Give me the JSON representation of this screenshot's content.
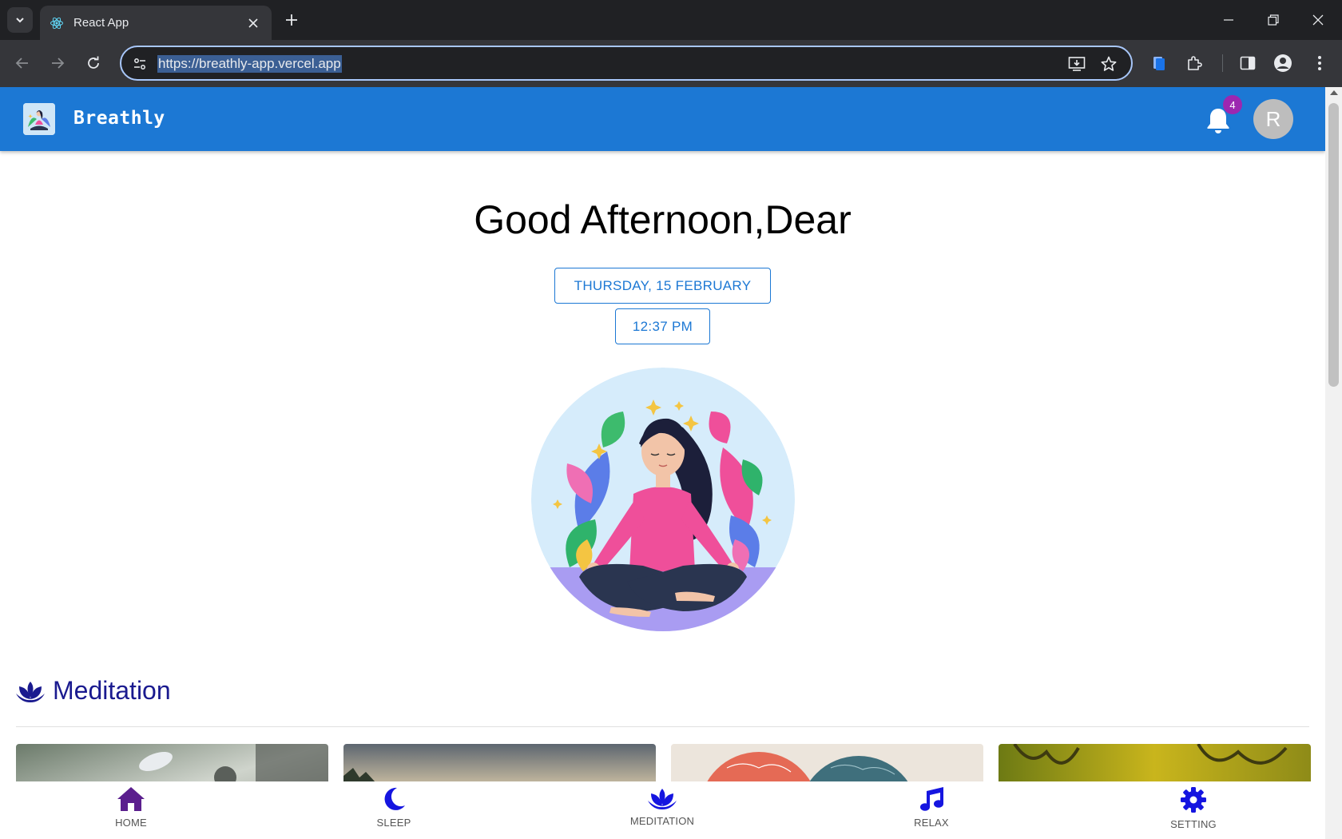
{
  "browser": {
    "tab_title": "React App",
    "url": "https://breathly-app.vercel.app"
  },
  "app": {
    "brand": "Breathly",
    "notification_count": "4",
    "avatar_initial": "R"
  },
  "main": {
    "greeting": "Good Afternoon,Dear",
    "date": "THURSDAY, 15 FEBRUARY",
    "time": "12:37 PM"
  },
  "section": {
    "title": "Meditation"
  },
  "bottom_nav": {
    "items": [
      {
        "label": "HOME",
        "icon": "home-icon"
      },
      {
        "label": "SLEEP",
        "icon": "moon-icon"
      },
      {
        "label": "MEDITATION",
        "icon": "lotus-icon"
      },
      {
        "label": "RELAX",
        "icon": "music-note-icon"
      },
      {
        "label": "SETTING",
        "icon": "gear-icon"
      }
    ]
  },
  "colors": {
    "appbar": "#1c78d4",
    "badge": "#9c27b0",
    "section_title": "#1a1a8f",
    "nav_icon": "#1515e0",
    "home_icon": "#5b1f8e"
  }
}
